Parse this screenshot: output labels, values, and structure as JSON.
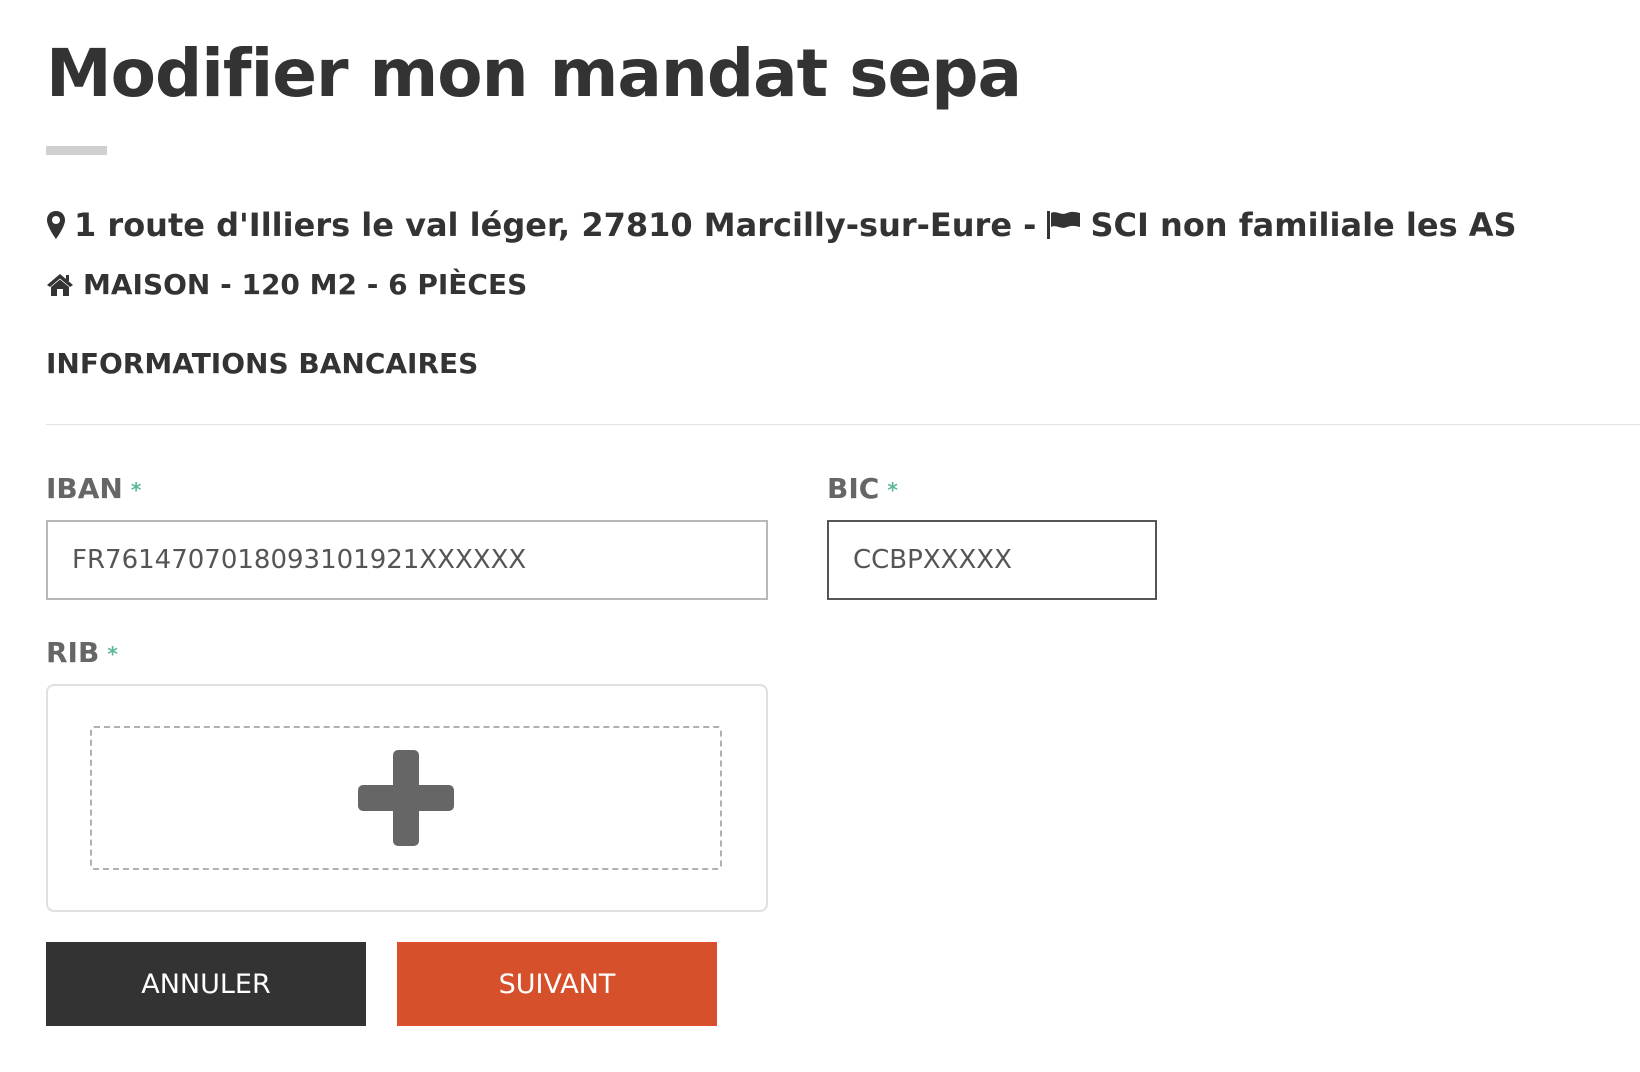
{
  "header": {
    "title": "Modifier mon mandat sepa"
  },
  "property": {
    "address": "1 route d'Illiers le val léger, 27810 Marcilly-sur-Eure -",
    "owner": "SCI non familiale les AS",
    "details": "MAISON - 120 M2 - 6 PIÈCES",
    "icons": {
      "address": "map-marker",
      "owner": "flag",
      "details": "home"
    }
  },
  "section": {
    "title": "INFORMATIONS BANCAIRES"
  },
  "form": {
    "iban": {
      "label": "IBAN",
      "required_marker": "*",
      "value": "FR7614707018093101921XXXXXX"
    },
    "bic": {
      "label": "BIC",
      "required_marker": "*",
      "value": "CCBPXXXXX"
    },
    "rib": {
      "label": "RIB",
      "required_marker": "*",
      "upload_icon": "plus"
    }
  },
  "actions": {
    "cancel_label": "ANNULER",
    "next_label": "SUIVANT"
  },
  "colors": {
    "text": "#333333",
    "label": "#666666",
    "required": "#5cb894",
    "cancel_button": "#333333",
    "next_button": "#d5502b"
  }
}
